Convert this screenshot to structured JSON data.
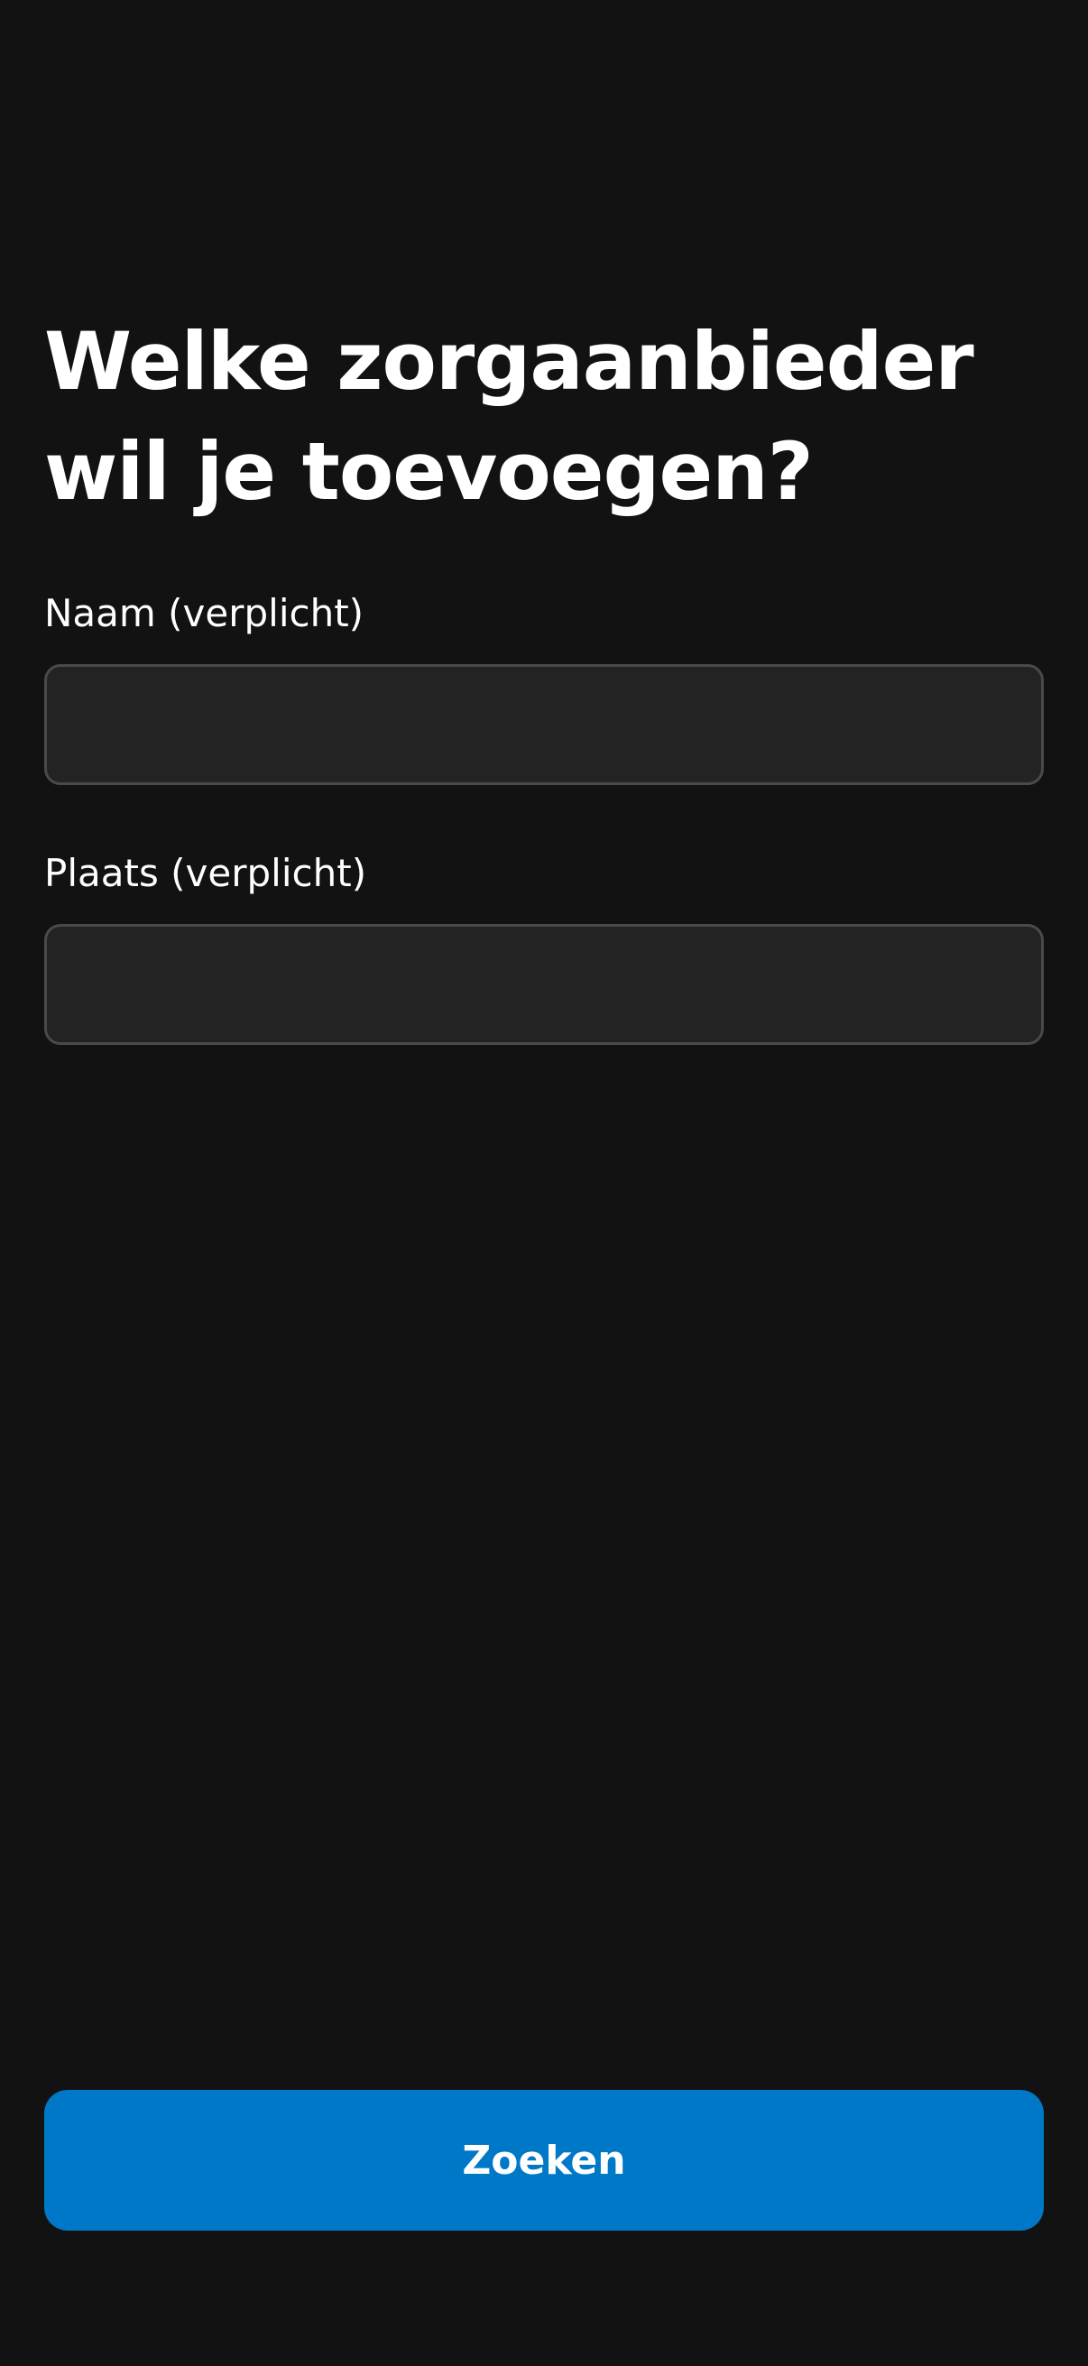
{
  "page": {
    "title": "Welke zorgaanbieder wil je toevoegen?"
  },
  "form": {
    "name_label": "Naam (verplicht)",
    "name_value": "",
    "name_placeholder": "",
    "place_label": "Plaats (verplicht)",
    "place_value": "",
    "place_placeholder": ""
  },
  "actions": {
    "search_label": "Zoeken"
  },
  "colors": {
    "background": "#121212",
    "input_background": "#232323",
    "input_border": "#4a4a4a",
    "primary": "#0078c8",
    "text": "#ffffff"
  }
}
